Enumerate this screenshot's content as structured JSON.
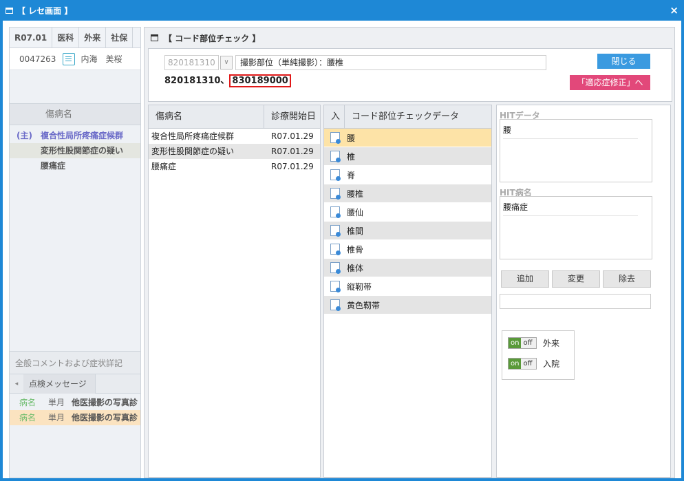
{
  "window": {
    "title": "【 レセ画面 】",
    "close": "×"
  },
  "left": {
    "header": [
      "R07.01",
      "医科",
      "外来",
      "社保"
    ],
    "patient_id": "0047263",
    "patient_name": "内海　美桜",
    "disease_header": "傷病名",
    "diseases": [
      {
        "tag": "(主)",
        "name": "複合性局所疼痛症候群"
      },
      {
        "tag": "",
        "name": "変形性股関節症の疑い"
      },
      {
        "tag": "",
        "name": "腰痛症"
      }
    ],
    "comment_label": "全般コメントおよび症状詳記",
    "check_tab": "点検メッセージ",
    "messages": [
      {
        "a": "病名",
        "b": "単月",
        "c": "他医撮影の写真診"
      },
      {
        "a": "病名",
        "b": "単月",
        "c": "他医撮影の写真診"
      }
    ]
  },
  "dialog": {
    "title": "【 コード部位チェック 】",
    "code_select": "820181310",
    "code_text": "撮影部位（単純撮影）：腰椎",
    "codes_prefix": "820181310、",
    "codes_highlight": "830189000",
    "close_btn": "閉じる",
    "fix_btn": "「適応症修正」へ",
    "disease_table": {
      "headers": [
        "傷病名",
        "診療開始日"
      ],
      "rows": [
        [
          "複合性局所疼痛症候群",
          "R07.01.29"
        ],
        [
          "変形性股関節症の疑い",
          "R07.01.29"
        ],
        [
          "腰痛症",
          "R07.01.29"
        ]
      ]
    },
    "check_table": {
      "headers": [
        "入",
        "コード部位チェックデータ"
      ],
      "rows": [
        "腰",
        "椎",
        "脊",
        "腰椎",
        "腰仙",
        "椎間",
        "椎骨",
        "椎体",
        "縦靭帯",
        "黄色靭帯"
      ]
    },
    "hit_data_label": "HITデータ",
    "hit_data": "腰",
    "hit_disease_label": "HIT病名",
    "hit_disease": "腰痛症",
    "btn_add": "追加",
    "btn_change": "変更",
    "btn_remove": "除去",
    "toggles": [
      {
        "on": "on",
        "off": "off",
        "label": "外来"
      },
      {
        "on": "on",
        "off": "off",
        "label": "入院"
      }
    ]
  },
  "colors": {
    "accent": "#1e88d6",
    "close_btn": "#3a9ae0",
    "fix_btn": "#e2487a",
    "selected_row": "#fde3a7",
    "highlight_border": "#e01818"
  }
}
